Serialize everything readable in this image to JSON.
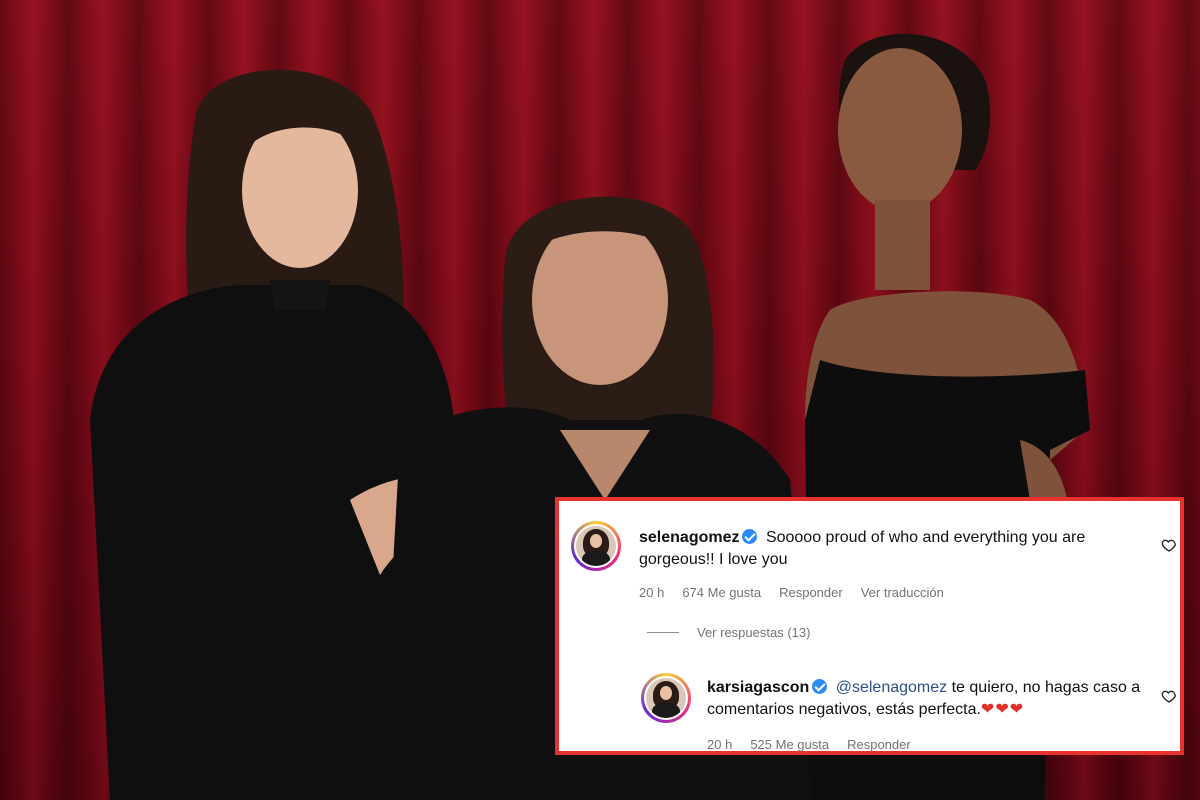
{
  "comments": [
    {
      "username": "selenagomez",
      "text": "Sooooo proud of who and everything you are gorgeous!! I love you",
      "time": "20 h",
      "likes": "674 Me gusta",
      "reply": "Responder",
      "translate": "Ver traducción"
    }
  ],
  "view_replies": "Ver respuestas (13)",
  "reply_comment": {
    "username": "karsiagascon",
    "mention": "@selenagomez",
    "text": " te quiero, no hagas caso a comentarios negativos, estás perfecta.",
    "hearts": "❤❤❤",
    "time": "20 h",
    "likes": "525 Me gusta",
    "reply": "Responder"
  },
  "colors": {
    "highlight_border": "#e8322f",
    "verified": "#2b8cf7",
    "curtain": "#7a0a17"
  },
  "icons": [
    "verified-badge-icon",
    "heart-like-icon",
    "heart-emoji"
  ]
}
